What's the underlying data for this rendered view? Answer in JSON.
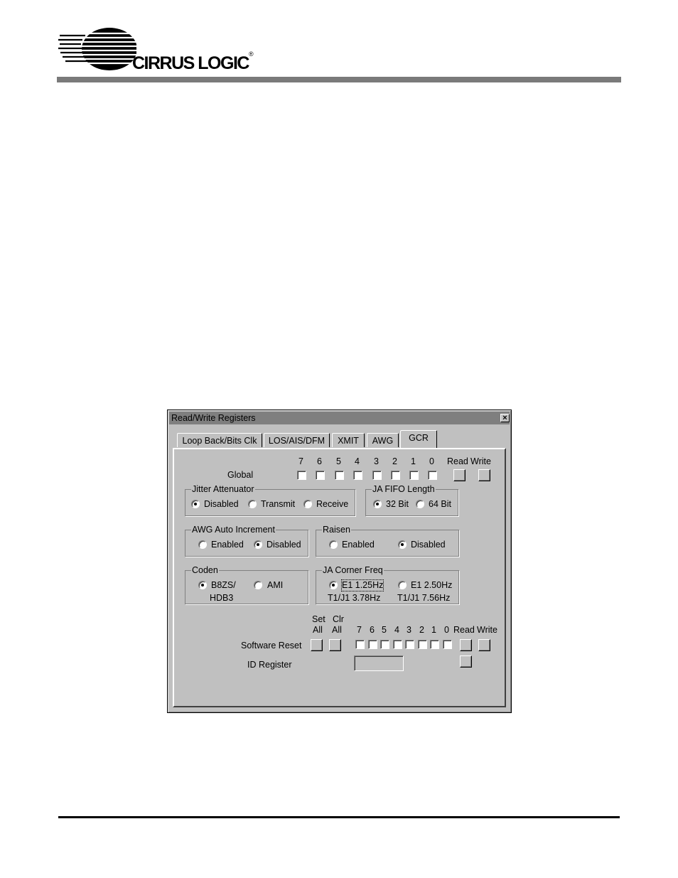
{
  "brand": {
    "name": "CIRRUS LOGIC",
    "reg": "®"
  },
  "dialog": {
    "title": "Read/Write Registers",
    "close": "×",
    "tabs": [
      "Loop Back/Bits Clk",
      "LOS/AIS/DFM",
      "XMIT",
      "AWG",
      "GCR"
    ],
    "active_tab": "GCR",
    "global": {
      "label": "Global",
      "bits": [
        "7",
        "6",
        "5",
        "4",
        "3",
        "2",
        "1",
        "0"
      ],
      "read": "Read",
      "write": "Write"
    },
    "jitter": {
      "legend": "Jitter Attenuator",
      "options": [
        "Disabled",
        "Transmit",
        "Receive"
      ],
      "selected": "Disabled"
    },
    "fifo": {
      "legend": "JA FIFO Length",
      "options": [
        "32 Bit",
        "64 Bit"
      ],
      "selected": "32 Bit"
    },
    "awg": {
      "legend": "AWG Auto Increment",
      "options": [
        "Enabled",
        "Disabled"
      ],
      "selected": "Disabled"
    },
    "raisen": {
      "legend": "Raisen",
      "options": [
        "Enabled",
        "Disabled"
      ],
      "selected": "Disabled"
    },
    "coden": {
      "legend": "Coden",
      "opt1_line1": "B8ZS/",
      "opt1_line2": "HDB3",
      "opt2": "AMI",
      "selected": "B8ZS/ HDB3"
    },
    "corner": {
      "legend": "JA Corner Freq",
      "opt1_line1": "E1 1.25Hz",
      "opt1_line2": "T1/J1 3.78Hz",
      "opt2_line1": "E1 2.50Hz",
      "opt2_line2": "T1/J1 7.56Hz",
      "selected": "E1 1.25Hz"
    },
    "reset": {
      "set_line1": "Set",
      "set_line2": "All",
      "clr_line1": "Clr",
      "clr_line2": "All",
      "bits": [
        "7",
        "6",
        "5",
        "4",
        "3",
        "2",
        "1",
        "0"
      ],
      "read": "Read",
      "write": "Write",
      "label": "Software Reset"
    },
    "id": {
      "label": "ID Register",
      "value": ""
    }
  }
}
